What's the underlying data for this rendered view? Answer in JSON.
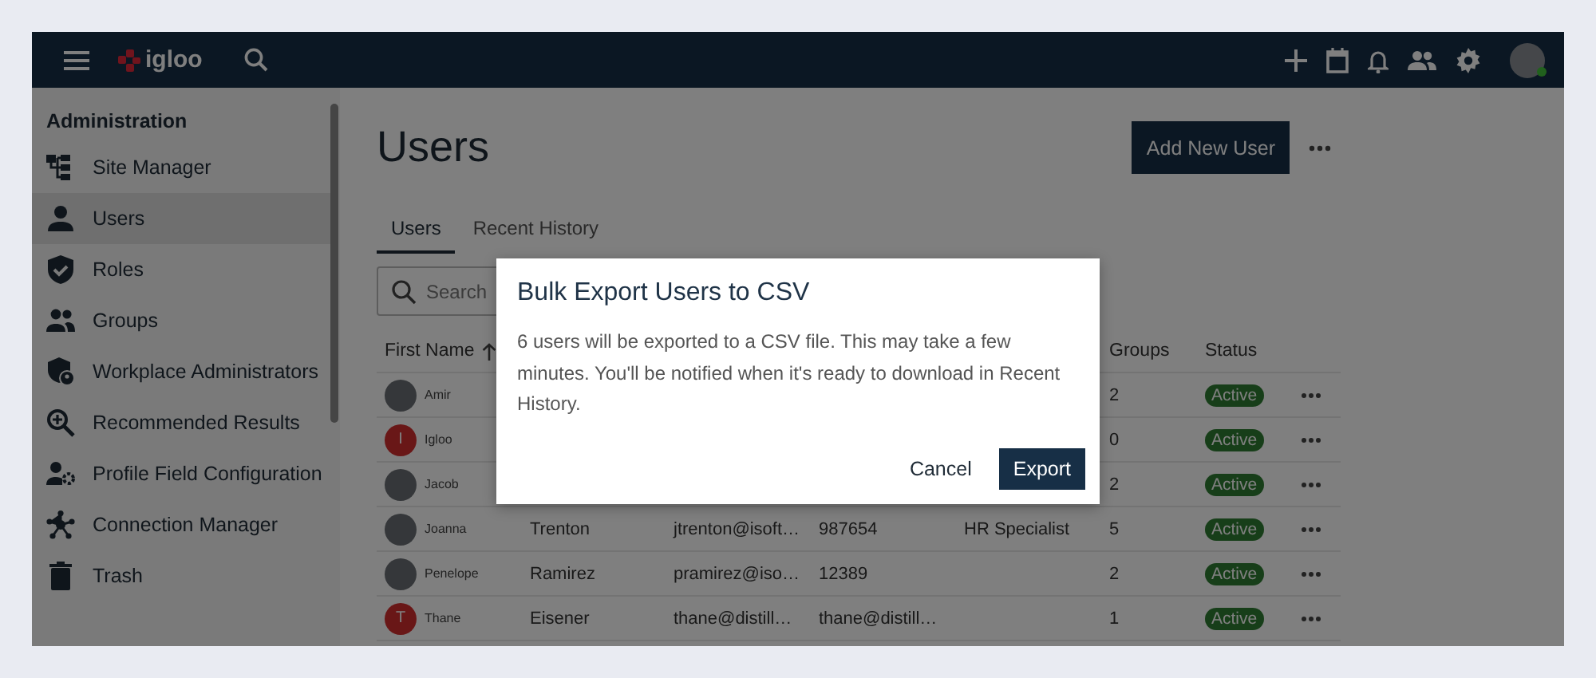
{
  "topbar": {
    "logo": "igloo",
    "avatar": {
      "online": true
    }
  },
  "sidebar": {
    "heading": "Administration",
    "items": [
      {
        "label": "Site Manager",
        "selected": false
      },
      {
        "label": "Users",
        "selected": true
      },
      {
        "label": "Roles",
        "selected": false
      },
      {
        "label": "Groups",
        "selected": false
      },
      {
        "label": "Workplace Administrators",
        "selected": false
      },
      {
        "label": "Recommended Results",
        "selected": false
      },
      {
        "label": "Profile Field Configuration",
        "selected": false
      },
      {
        "label": "Connection Manager",
        "selected": false
      },
      {
        "label": "Trash",
        "selected": false
      }
    ]
  },
  "page": {
    "title": "Users",
    "add_button": "Add New User"
  },
  "tabs": [
    {
      "label": "Users",
      "selected": true
    },
    {
      "label": "Recent History",
      "selected": false
    }
  ],
  "search": {
    "placeholder": "Search"
  },
  "table": {
    "columns": {
      "first_name": "First Name",
      "groups": "Groups",
      "status": "Status"
    },
    "rows": [
      {
        "first_name": "Amir",
        "avatar": {
          "kind": "photo"
        },
        "groups": "2",
        "status": "Active"
      },
      {
        "first_name": "Igloo",
        "avatar": {
          "kind": "initial",
          "letter": "I"
        },
        "groups": "0",
        "status": "Active"
      },
      {
        "first_name": "Jacob",
        "avatar": {
          "kind": "photo"
        },
        "groups": "2",
        "status": "Active"
      },
      {
        "first_name": "Joanna",
        "avatar": {
          "kind": "photo"
        },
        "last_name": "Trenton",
        "email": "jtrenton@isoft…",
        "column_4": "987654",
        "column_5": "HR Specialist",
        "groups": "5",
        "status": "Active"
      },
      {
        "first_name": "Penelope",
        "avatar": {
          "kind": "photo"
        },
        "last_name": "Ramirez",
        "email": "pramirez@iso…",
        "column_4": "12389",
        "groups": "2",
        "status": "Active"
      },
      {
        "first_name": "Thane",
        "avatar": {
          "kind": "initial",
          "letter": "T"
        },
        "last_name": "Eisener",
        "email": "thane@distill…",
        "column_4": "thane@distill…",
        "groups": "1",
        "status": "Active"
      }
    ]
  },
  "dialog": {
    "title": "Bulk Export Users to CSV",
    "message": "6 users will be exported to a CSV file. This may take a few minutes. You'll be notified when it's ready to download in Recent History.",
    "buttons": [
      {
        "label": "Cancel",
        "kind": "secondary"
      },
      {
        "label": "Export",
        "kind": "primary"
      }
    ]
  }
}
